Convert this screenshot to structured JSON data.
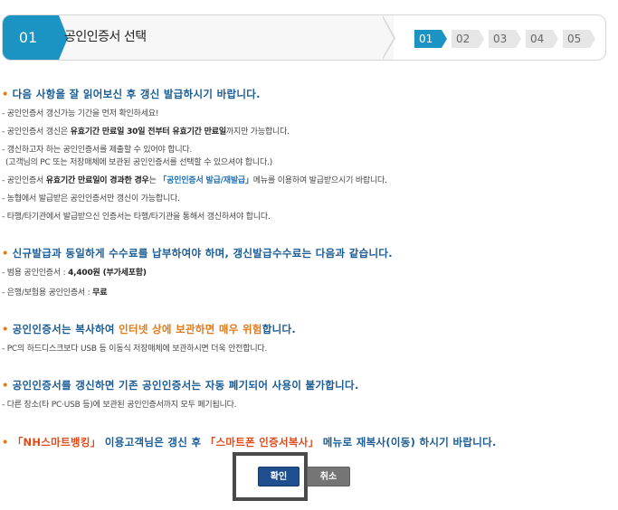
{
  "header": {
    "step_number": "01",
    "title": "공인인증서 선택",
    "steps": [
      "01",
      "02",
      "03",
      "04",
      "05"
    ],
    "active_step": "01"
  },
  "section1": {
    "heading": "다음 사항을 잘 읽어보신 후 갱신 발급하시기 바랍니다.",
    "line1": "- 공인인증서 갱신가능 기간을 먼저 확인하세요!",
    "line2_a": "- 공인인증서 갱신은 ",
    "line2_b": "유효기간 만료일 30일 전부터 유효기간 만료일",
    "line2_c": "까지만 가능합니다.",
    "line3": "- 갱신하고자 하는 공인인증서를 제출할 수 있어야 합니다.",
    "line4": "(고객님의 PC 또는 저장매체에 보관된 공인인증서를 선택할 수 있으셔야 합니다.)",
    "line5_a": "- 공인인증서 ",
    "line5_b": "유효기간 만료일이 경과한 경우",
    "line5_c": "는 ",
    "line5_d": "「공인인증서 발급/재발급」",
    "line5_e": "메뉴를 이용하여 발급받으시기 바랍니다.",
    "line6": "- 농협에서 발급받은 공인인증서만 갱신이 가능합니다.",
    "line7": "- 타행/타기관에서 발급받으신 인증서는 타행/타기관을 통해서 갱신하셔야 합니다."
  },
  "section2": {
    "heading": "신규발급과 동일하게 수수료를 납부하여야 하며, 갱신발급수수료는 다음과 같습니다.",
    "line1_a": "- 범용 공인인증서 : ",
    "line1_b": "4,400원 (부가세포함)",
    "line2_a": "- 은행/보험용 공인인증서 : ",
    "line2_b": "무료"
  },
  "section3": {
    "heading_a": "공인인증서는 복사하여 ",
    "heading_b": "인터넷 상에 보관하면 매우 위험",
    "heading_c": "합니다.",
    "line1": "- PC의 하드디스크보다 USB 등 이동식 저장매체에 보관하시면 더욱 안전합니다."
  },
  "section4": {
    "heading": "공인인증서를 갱신하면 기존 공인인증서는 자동 폐기되어 사용이 불가합니다.",
    "line1": "- 다른 장소(타 PC·USB 등)에 보관된 공인인증서까지 모두 폐기됩니다."
  },
  "section5": {
    "heading_a": "「NH스마트뱅킹」",
    "heading_b": " 이용고객님은 갱신 후 ",
    "heading_c": "「스마트폰 인증서복사」",
    "heading_d": " 메뉴로 재복사(이동) 하시기 바랍니다."
  },
  "buttons": {
    "confirm": "확인",
    "cancel": "취소"
  },
  "bullet_glyph": "•"
}
